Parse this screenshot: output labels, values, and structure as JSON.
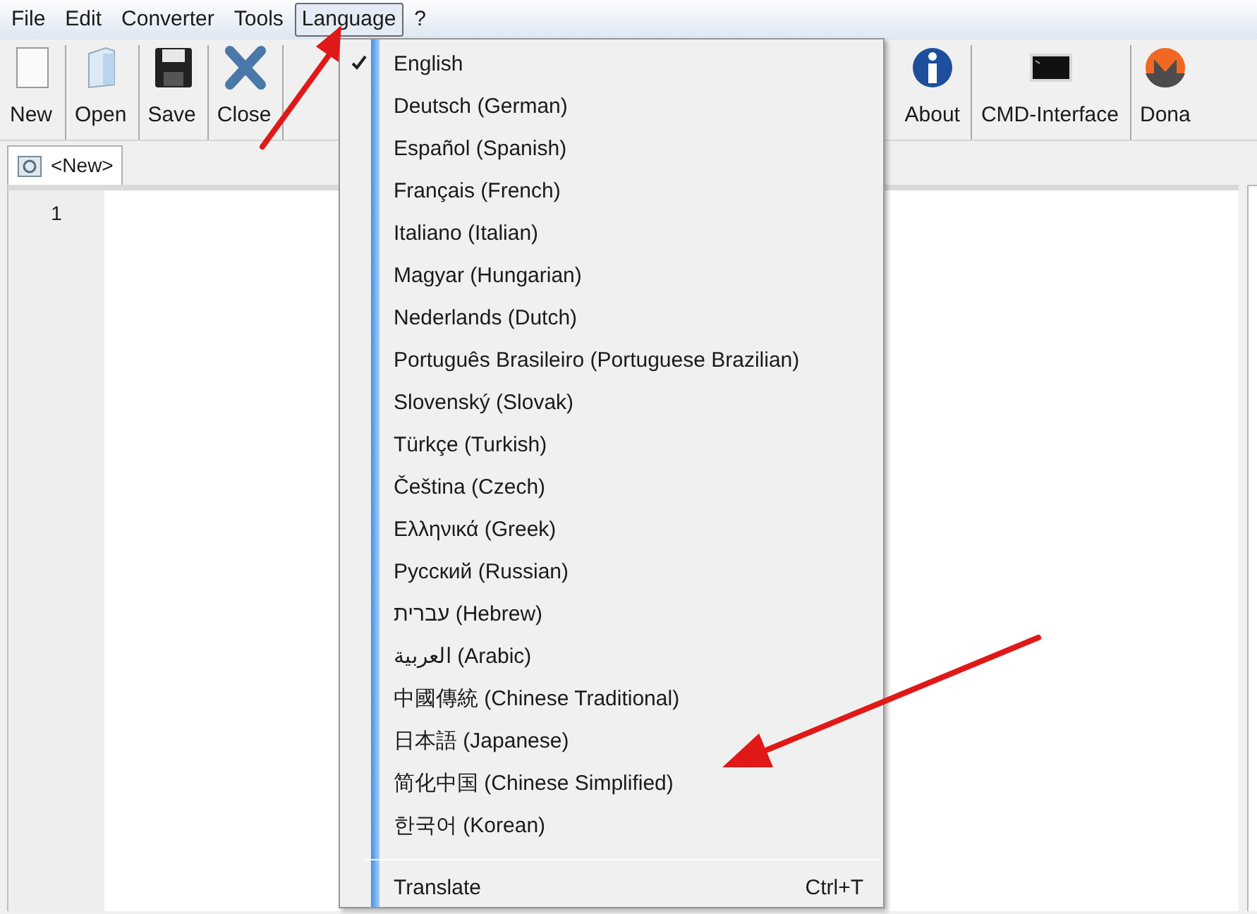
{
  "menubar": [
    {
      "label": "File",
      "selected": false
    },
    {
      "label": "Edit",
      "selected": false
    },
    {
      "label": "Converter",
      "selected": false
    },
    {
      "label": "Tools",
      "selected": false
    },
    {
      "label": "Language",
      "selected": true
    },
    {
      "label": "?",
      "selected": false
    }
  ],
  "toolbar_left": [
    {
      "label": "New",
      "kind": "new"
    },
    {
      "label": "Open",
      "kind": "open"
    },
    {
      "label": "Save",
      "kind": "save"
    },
    {
      "label": "Close",
      "kind": "close"
    }
  ],
  "toolbar_right": [
    {
      "label": "About",
      "kind": "about"
    },
    {
      "label": "CMD-Interface",
      "kind": "cmd"
    },
    {
      "label": "Dona",
      "kind": "donate"
    }
  ],
  "tab": {
    "label": "<New>"
  },
  "editor": {
    "line_numbers": [
      "1"
    ]
  },
  "language_menu": {
    "items": [
      {
        "label": "English",
        "checked": true
      },
      {
        "label": "Deutsch (German)",
        "checked": false
      },
      {
        "label": "Español (Spanish)",
        "checked": false
      },
      {
        "label": "Français (French)",
        "checked": false
      },
      {
        "label": "Italiano (Italian)",
        "checked": false
      },
      {
        "label": "Magyar (Hungarian)",
        "checked": false
      },
      {
        "label": "Nederlands (Dutch)",
        "checked": false
      },
      {
        "label": "Português Brasileiro (Portuguese Brazilian)",
        "checked": false
      },
      {
        "label": "Slovenský (Slovak)",
        "checked": false
      },
      {
        "label": "Türkçe (Turkish)",
        "checked": false
      },
      {
        "label": "Čeština (Czech)",
        "checked": false
      },
      {
        "label": "Ελληνικά (Greek)",
        "checked": false
      },
      {
        "label": "Русский (Russian)",
        "checked": false
      },
      {
        "label": "עברית (Hebrew)",
        "checked": false
      },
      {
        "label": "العربية (Arabic)",
        "checked": false
      },
      {
        "label": "中國傳統 (Chinese Traditional)",
        "checked": false
      },
      {
        "label": "日本語 (Japanese)",
        "checked": false
      },
      {
        "label": "简化中国 (Chinese Simplified)",
        "checked": false
      },
      {
        "label": "한국어 (Korean)",
        "checked": false
      }
    ],
    "footer": {
      "label": "Translate",
      "shortcut": "Ctrl+T"
    }
  }
}
